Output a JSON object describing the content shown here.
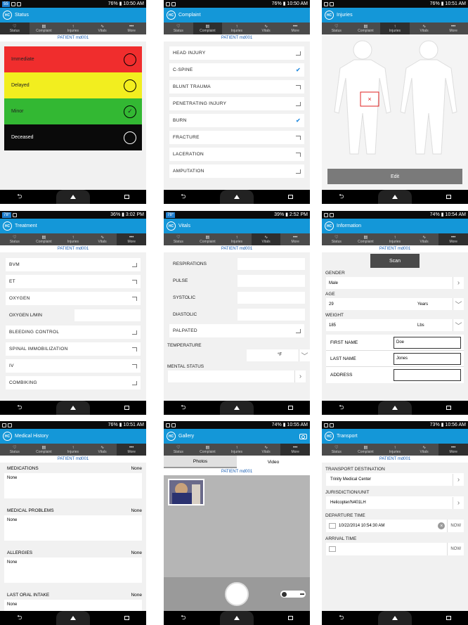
{
  "status_bar": {
    "p1": {
      "time": "10:50 AM",
      "battery": "76%",
      "badge": "55"
    },
    "p2": {
      "time": "10:50 AM",
      "battery": "76%"
    },
    "p3": {
      "time": "10:51 AM",
      "battery": "76%"
    },
    "p4": {
      "time": "3:02 PM",
      "battery": "36%",
      "badge": "78°"
    },
    "p5": {
      "time": "2:52 PM",
      "battery": "39%",
      "badge": "78°"
    },
    "p6": {
      "time": "10:54 AM",
      "battery": "74%"
    },
    "p7": {
      "time": "10:51 AM",
      "battery": "76%"
    },
    "p8": {
      "time": "10:55 AM",
      "battery": "74%"
    },
    "p9": {
      "time": "10:56 AM",
      "battery": "73%"
    }
  },
  "logo": "HC",
  "tabs": [
    "Status",
    "Complaint",
    "Injuries",
    "Vitals",
    "More"
  ],
  "patient_label": "PATIENT md001",
  "screens": {
    "status": {
      "title": "Status",
      "items": [
        {
          "label": "Immediate",
          "color": "#f02d2d",
          "selected": false
        },
        {
          "label": "Delayed",
          "color": "#f2ee1f",
          "selected": false
        },
        {
          "label": "Minor",
          "color": "#33b833",
          "selected": true
        },
        {
          "label": "Deceased",
          "color": "#0a0a0a",
          "selected": false
        }
      ]
    },
    "complaint": {
      "title": "Complaint",
      "items": [
        {
          "label": "HEAD INJURY",
          "checked": false
        },
        {
          "label": "C-SPINE",
          "checked": true
        },
        {
          "label": "BLUNT TRAUMA",
          "checked": false
        },
        {
          "label": "PENETRATING INJURY",
          "checked": false
        },
        {
          "label": "BURN",
          "checked": true
        },
        {
          "label": "FRACTURE",
          "checked": false
        },
        {
          "label": "LACERATION",
          "checked": false
        },
        {
          "label": "AMPUTATION",
          "checked": false
        }
      ]
    },
    "injuries": {
      "title": "Injuries",
      "edit_label": "Edit",
      "marker": "×"
    },
    "treatment": {
      "title": "Treatment",
      "items": [
        {
          "label": "BVM",
          "type": "check"
        },
        {
          "label": "ET",
          "type": "check"
        },
        {
          "label": "OXYGEN",
          "type": "check"
        },
        {
          "label": "OXYGEN L/MIN",
          "type": "input"
        },
        {
          "label": "BLEEDING CONTROL",
          "type": "check"
        },
        {
          "label": "SPINAL IMMOBILIZATION",
          "type": "check"
        },
        {
          "label": "IV",
          "type": "check"
        },
        {
          "label": "COMBIKING",
          "type": "check"
        }
      ]
    },
    "vitals": {
      "title": "Vitals",
      "fields": [
        "RESPIRATIONS",
        "PULSE",
        "SYSTOLIC",
        "DIASTOLIC"
      ],
      "palpated": "PALPATED",
      "temperature_label": "TEMPERATURE",
      "temp_unit": "°F",
      "mental_status_label": "MENTAL STATUS"
    },
    "information": {
      "title": "Information",
      "scan_label": "Scan",
      "gender_label": "GENDER",
      "gender_value": "Male",
      "age_label": "AGE",
      "age_value": "29",
      "age_unit": "Years",
      "weight_label": "WEIGHT",
      "weight_value": "185",
      "weight_unit": "Lbs",
      "first_name_label": "FIRST NAME",
      "first_name_value": "Doe",
      "last_name_label": "LAST NAME",
      "last_name_value": "Jones",
      "address_label": "ADDRESS"
    },
    "medical_history": {
      "title": "Medical History",
      "sections": [
        {
          "label": "MEDICATIONS",
          "right": "None",
          "value": "None"
        },
        {
          "label": "MEDICAL PROBLEMS",
          "right": "None",
          "value": "None"
        },
        {
          "label": "ALLERGIES",
          "right": "None",
          "value": "None"
        },
        {
          "label": "LAST ORAL INTAKE",
          "right": "None",
          "value": "None"
        }
      ]
    },
    "gallery": {
      "title": "Gallery",
      "tab_photos": "Photos",
      "tab_video": "Video"
    },
    "transport": {
      "title": "Transport",
      "destination_label": "TRANSPORT DESTINATION",
      "destination_value": "Trinity Medical Center",
      "jurisdiction_label": "JURISDICTION/UNIT",
      "jurisdiction_value": "Helicopter/N401LH",
      "departure_label": "DEPARTURE TIME",
      "departure_value": "10/22/2014 10:54:30 AM",
      "now_label": "NOW",
      "arrival_label": "ARRIVAL TIME"
    }
  }
}
